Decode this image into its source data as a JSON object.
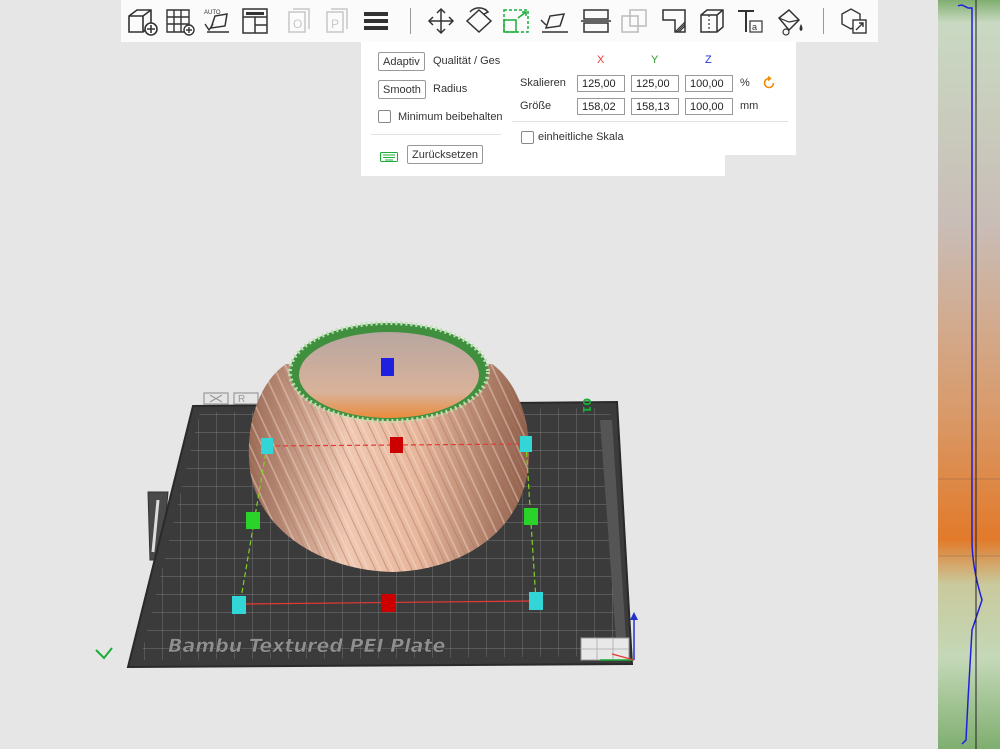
{
  "toolbar": {
    "icons": [
      "add-object-icon",
      "grid-arrange-icon",
      "auto-orient-icon",
      "layout-icon",
      "plate-object-icon",
      "plate-p-icon",
      "layers-icon",
      "move-icon",
      "rotate-icon",
      "scale-icon",
      "place-on-face-icon",
      "cut-icon",
      "boolean-icon",
      "support-paint-icon",
      "seam-icon",
      "text-icon",
      "paint-bucket-icon",
      "assembly-icon"
    ]
  },
  "left_panel": {
    "adaptive_label": "Adaptiv",
    "quality_label": "Qualität / Ges",
    "smooth_label": "Smooth",
    "radius_label": "Radius",
    "keep_min_label": "Minimum beibehalten",
    "reset_label": "Zurücksetzen"
  },
  "scale_panel": {
    "axis_x": "X",
    "axis_y": "Y",
    "axis_z": "Z",
    "scale_label": "Skalieren",
    "scale_x": "125,00",
    "scale_y": "125,00",
    "scale_z": "100,00",
    "scale_unit": "%",
    "size_label": "Größe",
    "size_x": "158,02",
    "size_y": "158,13",
    "size_z": "100,00",
    "size_unit": "mm",
    "uniform_label": "einheitliche Skala"
  },
  "viewport": {
    "plate_name": "Bambu Textured PEI Plate",
    "plate_number": "01"
  },
  "colors": {
    "axis_x": "#e53935",
    "axis_y": "#2e9d2e",
    "axis_z": "#2233cc",
    "accent": "#1aae39",
    "reset_orange": "#f08c00"
  }
}
